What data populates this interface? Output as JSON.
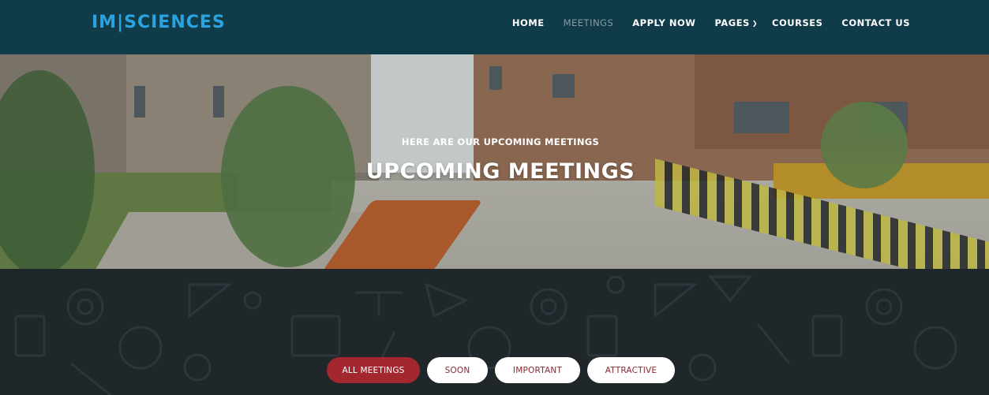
{
  "brand": {
    "logo_text": "IM|SCIENCES",
    "color": "#2aa3e0"
  },
  "nav": {
    "items": [
      {
        "label": "HOME",
        "active": false
      },
      {
        "label": "MEETINGS",
        "active": true
      },
      {
        "label": "APPLY NOW",
        "active": false
      },
      {
        "label": "PAGES",
        "active": false,
        "has_dropdown": true,
        "icon": "chevron-down-icon"
      },
      {
        "label": "COURSES",
        "active": false
      },
      {
        "label": "CONTACT US",
        "active": false
      }
    ]
  },
  "hero": {
    "subtitle": "HERE ARE OUR UPCOMING MEETINGS",
    "title": "UPCOMING MEETINGS"
  },
  "filters": {
    "items": [
      {
        "label": "ALL MEETINGS",
        "active": true
      },
      {
        "label": "SOON",
        "active": false
      },
      {
        "label": "IMPORTANT",
        "active": false
      },
      {
        "label": "ATTRACTIVE",
        "active": false
      }
    ],
    "accent_color": "#a3272f"
  },
  "colors": {
    "header_bg": "#103b48",
    "content_bg": "#1f272b"
  }
}
